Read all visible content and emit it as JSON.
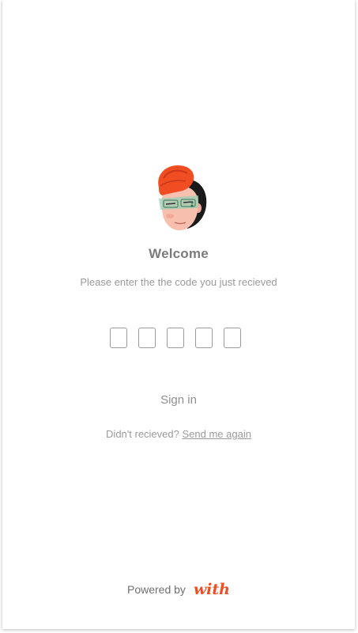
{
  "header": {
    "title": "Welcome",
    "subtitle": "Please enter the the code you just recieved"
  },
  "code_inputs": [
    {
      "value": ""
    },
    {
      "value": ""
    },
    {
      "value": ""
    },
    {
      "value": ""
    },
    {
      "value": ""
    }
  ],
  "actions": {
    "sign_in_label": "Sign in",
    "resend_prompt": "Didn't recieved?",
    "resend_link": "Send me again"
  },
  "footer": {
    "powered_by": "Powered by",
    "brand": "with"
  },
  "colors": {
    "brand": "#f04d23",
    "text_muted": "#9a9a9a",
    "avatar_hair": "#f04d23"
  },
  "icons": {
    "avatar": "avatar-illustration"
  }
}
